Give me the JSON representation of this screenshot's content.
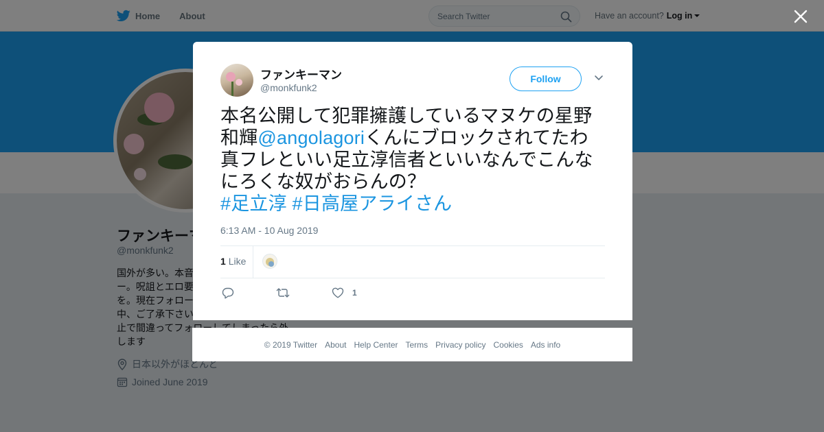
{
  "nav": {
    "home_label": "Home",
    "about_label": "About"
  },
  "search": {
    "placeholder": "Search Twitter"
  },
  "account": {
    "prompt": "Have an account?",
    "login_label": "Log in"
  },
  "profile": {
    "name": "ファンキーマン",
    "handle": "@monkfunk2",
    "bio_lines": [
      "国外が多い。本音",
      "ー。呪詛とエロ要",
      "を。現在フォロー",
      "中、ご了承下さい",
      "止で間違ってフォローしてしまったら外",
      "します"
    ],
    "location": "日本以外がほとんど",
    "joined": "Joined June 2019"
  },
  "tweet": {
    "author_name": "ファンキーマン",
    "author_handle": "@monkfunk2",
    "follow_label": "Follow",
    "text_line1": "本名公開して犯罪擁護しているマヌケの星野",
    "text_line2_pre": "和輝",
    "text_line2_mention": "@angolagori",
    "text_line2_post": "くんにブロックされてたわ",
    "text_line3": "真フレといい足立淳信者といいなんでこんな",
    "text_line4": "にろくな奴がおらんの？",
    "hashtag1": "#足立淳",
    "hashtag2": "#日高屋アライさん",
    "timestamp": "6:13 AM - 10 Aug 2019",
    "like_count": "1",
    "like_label": "Like",
    "action_like_count": "1"
  },
  "footer": {
    "copyright": "© 2019 Twitter",
    "about": "About",
    "help": "Help Center",
    "terms": "Terms",
    "privacy": "Privacy policy",
    "cookies": "Cookies",
    "ads": "Ads info"
  },
  "colors": {
    "brand_blue": "#1da1f2",
    "link_blue": "#1b95e0",
    "muted_gray": "#657786",
    "overlay": "rgba(0,0,0,0.5)"
  },
  "icons": {
    "logo": "twitter-bird-icon",
    "search": "search-icon",
    "close": "close-icon",
    "more": "chevron-down-icon",
    "reply": "reply-icon",
    "retweet": "retweet-icon",
    "like": "heart-icon",
    "location": "location-pin-icon",
    "calendar": "calendar-icon"
  }
}
